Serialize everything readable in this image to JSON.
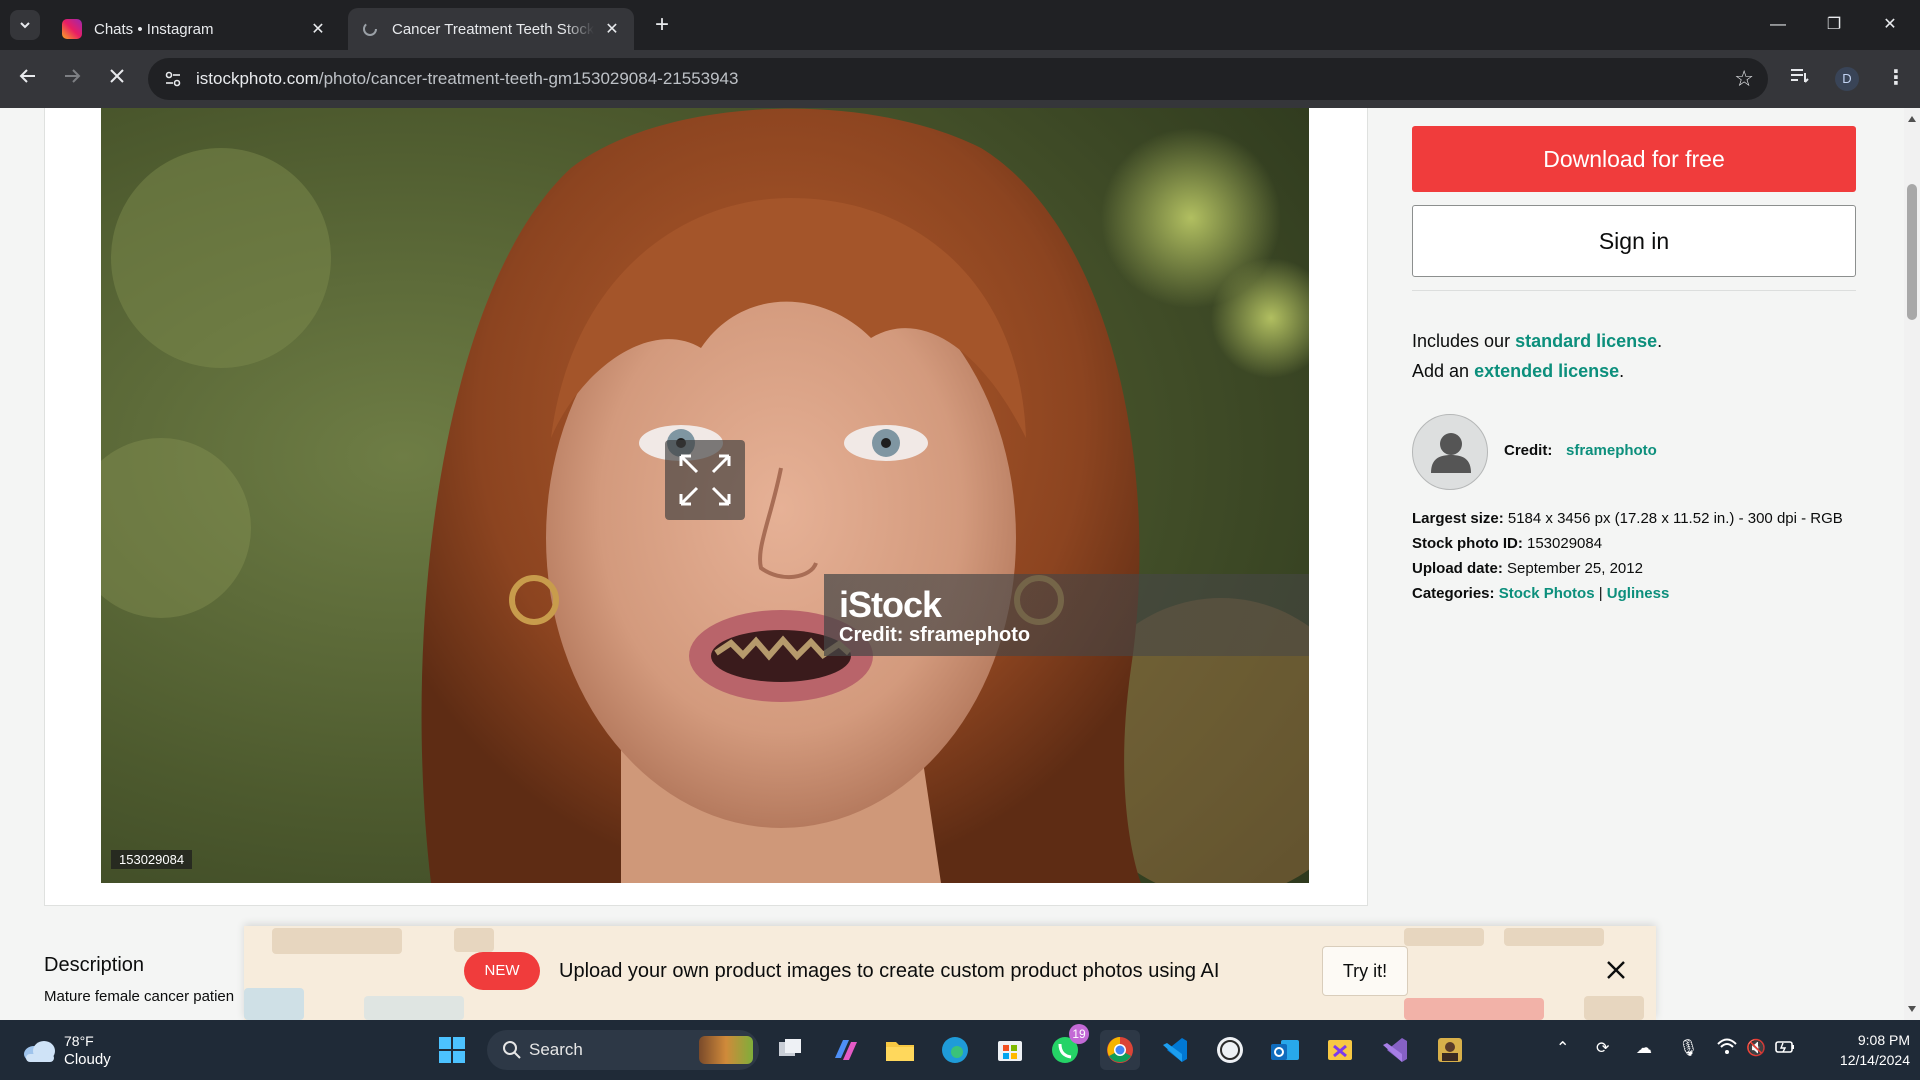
{
  "browser": {
    "tabs": [
      {
        "title": "Chats • Instagram",
        "active": false
      },
      {
        "title": "Cancer Treatment Teeth Stock Photo",
        "active": true
      }
    ],
    "url_domain": "istockphoto.com",
    "url_path": "/photo/cancer-treatment-teeth-gm153029084-21553943",
    "profile_initial": "D"
  },
  "page": {
    "photo_id_label": "153029084",
    "watermark_logo": "iStock",
    "watermark_credit": "Credit: sframephoto",
    "buttons": {
      "download": "Download for free",
      "signin": "Sign in"
    },
    "license": {
      "line1_prefix": "Includes our ",
      "line1_link": "standard license",
      "line1_suffix": ".",
      "line2_prefix": "Add an ",
      "line2_link": "extended license",
      "line2_suffix": "."
    },
    "credit": {
      "label": "Credit:",
      "name": "sframephoto"
    },
    "meta": {
      "largest_size_label": "Largest size:",
      "largest_size_value": " 5184 x 3456 px (17.28 x 11.52 in.) - 300 dpi - RGB",
      "stock_id_label": "Stock photo ID:",
      "stock_id_value": " 153029084",
      "upload_date_label": "Upload date:",
      "upload_date_value": " September 25, 2012",
      "categories_label": "Categories:",
      "categories": [
        "Stock Photos",
        "Ugliness"
      ],
      "categories_separator": " | "
    },
    "description": {
      "heading": "Description",
      "text": "Mature female cancer patien"
    },
    "promo": {
      "badge": "NEW",
      "text": "Upload your own product images to create custom product photos using AI",
      "cta": "Try it!"
    }
  },
  "taskbar": {
    "weather_temp": "78°F",
    "weather_condition": "Cloudy",
    "search_label": "Search",
    "whatsapp_badge": "19",
    "time": "9:08 PM",
    "date": "12/14/2024"
  },
  "colors": {
    "accent_red": "#f03c3c",
    "link_teal": "#0c8f7c",
    "chrome_dark": "#202124",
    "chrome_toolbar": "#35363a",
    "taskbar_bg": "#1f2a37"
  }
}
